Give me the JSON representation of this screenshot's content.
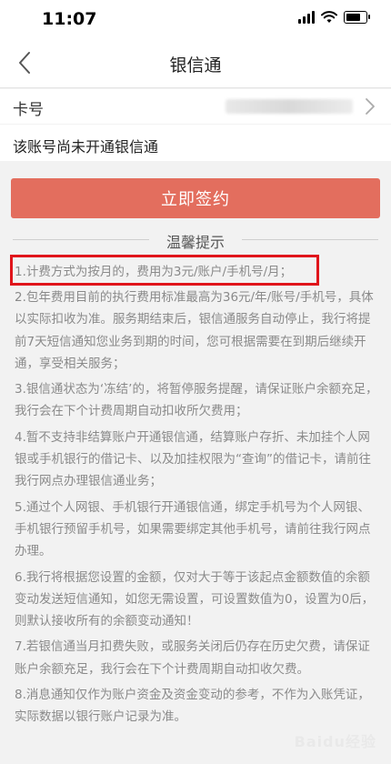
{
  "status_bar": {
    "time": "11:07"
  },
  "nav": {
    "title": "银信通"
  },
  "card": {
    "label": "卡号"
  },
  "account_status": "该账号尚未开通银信通",
  "sign_button": "立即签约",
  "tips": {
    "title": "温馨提示",
    "items": [
      "1.计费方式为按月的，费用为3元/账户/手机号/月；",
      "2.包年费用目前的执行费用标准最高为36元/年/账号/手机号，具体以实际扣收为准。服务期结束后，银信通服务自动停止，我行将提前7天短信通知您业务到期的时间，您可根据需要在到期后继续开通，享受相关服务；",
      "3.银信通状态为‘冻结’的，将暂停服务提醒，请保证账户余额充足，我行会在下个计费周期自动扣收所欠费用；",
      "4.暂不支持非结算账户开通银信通，结算账户存折、未加挂个人网银或手机银行的借记卡、以及加挂权限为“查询”的借记卡，请前往我行网点办理银信通业务；",
      "5.通过个人网银、手机银行开通银信通，绑定手机号为个人网银、手机银行预留手机号，如果需要绑定其他手机号，请前往我行网点办理。",
      "6.我行将根据您设置的金额，仅对大于等于该起点金额数值的余额变动发送短信通知，如您无需设置，可设置数值为0，设置为0后，则默认接收所有的余额变动通知！",
      "7.若银信通当月扣费失败，或服务关闭后仍存在历史欠费，请保证账户余额充足，我行会在下个计费周期自动扣收欠费。",
      "8.消息通知仅作为账户资金及资金变动的参考，不作为入账凭证，实际数据以银行账户记录为准。"
    ]
  },
  "watermark": "Baidu经验"
}
